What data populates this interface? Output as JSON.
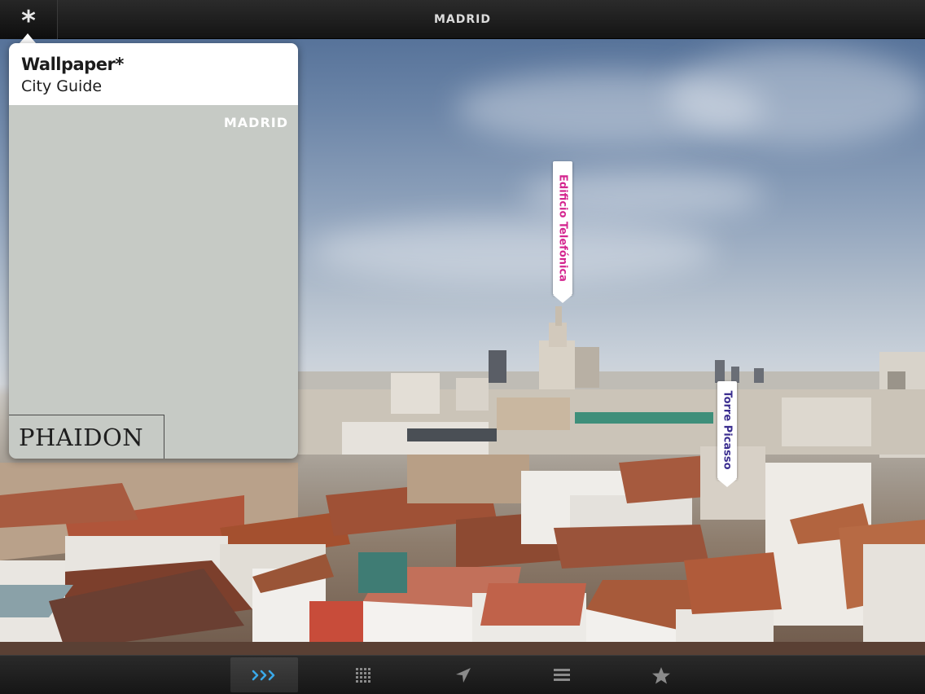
{
  "header": {
    "title": "MADRID",
    "menu_icon": "asterisk-icon",
    "menu_glyph": "*"
  },
  "cover": {
    "title": "Wallpaper*",
    "subtitle": "City Guide",
    "city": "MADRID",
    "publisher": "PHAIDON"
  },
  "landmarks": [
    {
      "label": "Edificio Telefónica",
      "color": "#d4268f"
    },
    {
      "label": "Torre Picasso",
      "color": "#3a2d8f"
    }
  ],
  "tabbar": {
    "items": [
      {
        "icon": "chevrons-right-icon",
        "active": true
      },
      {
        "icon": "grid-icon",
        "active": false
      },
      {
        "icon": "location-arrow-icon",
        "active": false
      },
      {
        "icon": "list-icon",
        "active": false
      },
      {
        "icon": "star-icon",
        "active": false
      }
    ],
    "active_color": "#3aa8e8",
    "inactive_color": "#8a8a8a"
  }
}
